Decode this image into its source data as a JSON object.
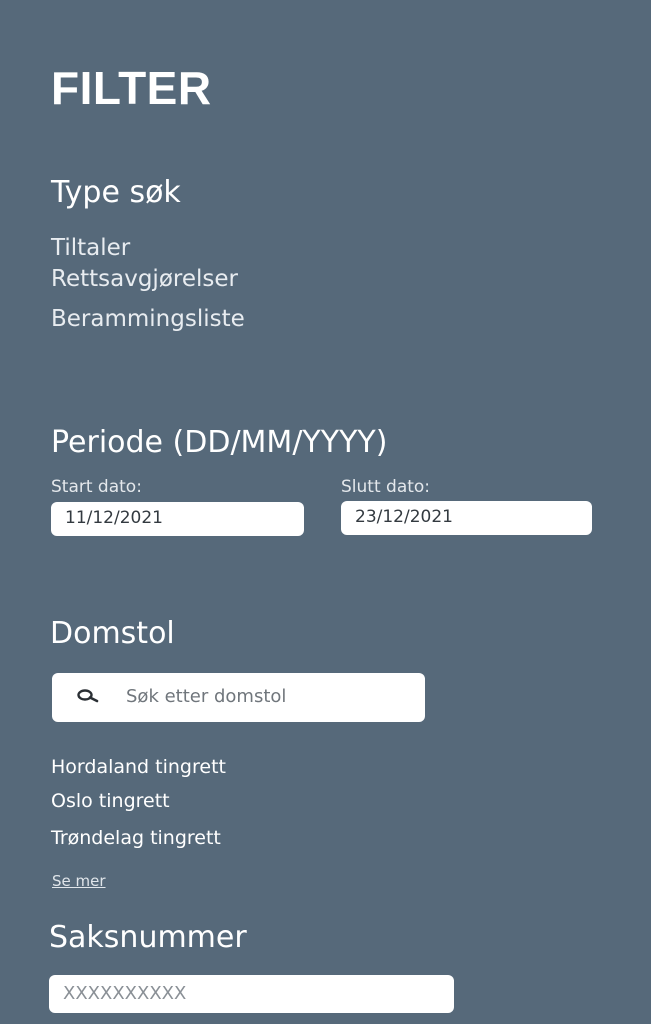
{
  "page": {
    "title": "FILTER"
  },
  "type_search": {
    "heading": "Type søk",
    "options": [
      "Tiltaler",
      "Rettsavgjørelser",
      "Berammingsliste"
    ]
  },
  "period": {
    "heading": "Periode (DD/MM/YYYY)",
    "start_label": "Start dato:",
    "start_value": "11/12/2021",
    "end_label": "Slutt dato:",
    "end_value": "23/12/2021"
  },
  "court": {
    "heading": "Domstol",
    "search_placeholder": "Søk etter domstol",
    "search_icon": "search-icon",
    "items": [
      "Hordaland tingrett",
      "Oslo tingrett",
      "Trøndelag tingrett"
    ],
    "see_more": "Se mer"
  },
  "case_number": {
    "heading": "Saksnummer",
    "placeholder": "XXXXXXXXXX"
  },
  "colors": {
    "background": "#56697a",
    "text": "#ffffff",
    "input_background": "#ffffff"
  }
}
